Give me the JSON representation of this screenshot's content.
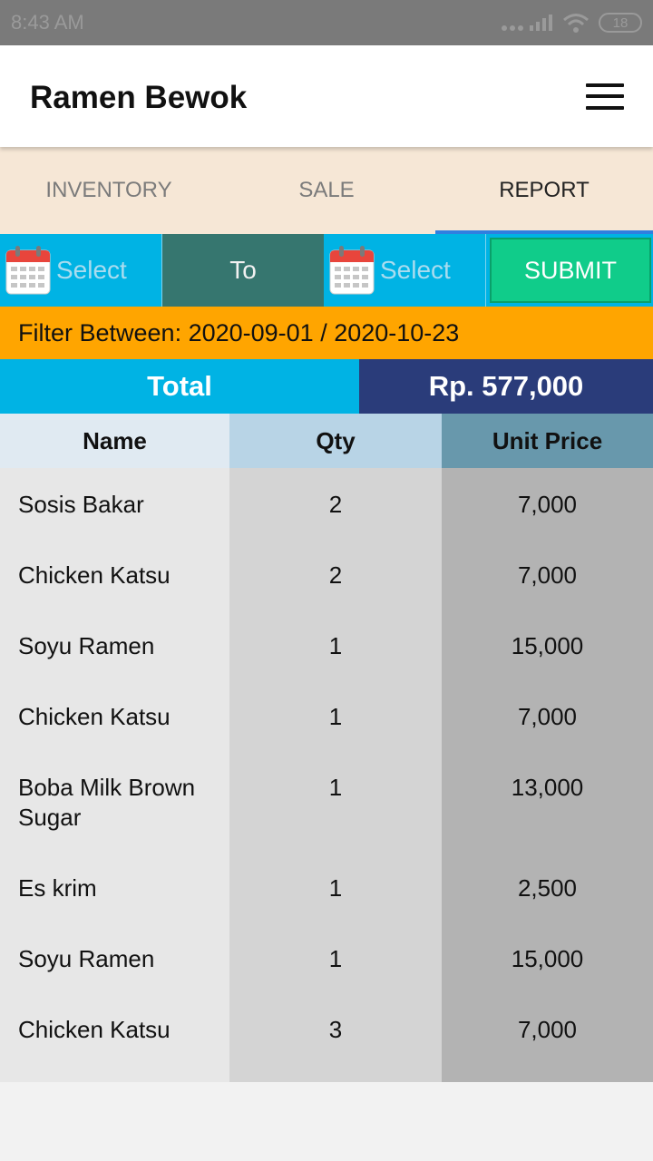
{
  "status_bar": {
    "time": "8:43 AM",
    "battery": "18"
  },
  "app_bar": {
    "title": "Ramen Bewok"
  },
  "tabs": [
    {
      "label": "INVENTORY",
      "active": false
    },
    {
      "label": "SALE",
      "active": false
    },
    {
      "label": "REPORT",
      "active": true
    }
  ],
  "filter": {
    "from_label": "Select",
    "to_label": "To",
    "until_label": "Select",
    "submit_label": "SUBMIT",
    "info": "Filter Between: 2020-09-01 / 2020-10-23"
  },
  "total": {
    "label": "Total",
    "value": "Rp. 577,000"
  },
  "table": {
    "headers": [
      "Name",
      "Qty",
      "Unit Price"
    ],
    "rows": [
      {
        "name": "Sosis Bakar",
        "qty": "2",
        "price": "7,000"
      },
      {
        "name": "Chicken Katsu",
        "qty": "2",
        "price": "7,000"
      },
      {
        "name": "Soyu Ramen",
        "qty": "1",
        "price": "15,000"
      },
      {
        "name": "Chicken Katsu",
        "qty": "1",
        "price": "7,000"
      },
      {
        "name": "Boba Milk Brown Sugar",
        "qty": "1",
        "price": "13,000"
      },
      {
        "name": "Es krim",
        "qty": "1",
        "price": "2,500"
      },
      {
        "name": "Soyu Ramen",
        "qty": "1",
        "price": "15,000"
      },
      {
        "name": "Chicken Katsu",
        "qty": "3",
        "price": "7,000"
      }
    ]
  },
  "colors": {
    "accent_blue": "#00b3e4",
    "to_green": "#36766f",
    "submit_green": "#10cc8a",
    "filter_orange": "#ffa500",
    "total_navy": "#2a3c7a",
    "tab_indicator": "#2f7fe0"
  },
  "icons": [
    "signal-icon",
    "wifi-icon",
    "battery-icon",
    "menu-icon",
    "calendar-icon"
  ]
}
